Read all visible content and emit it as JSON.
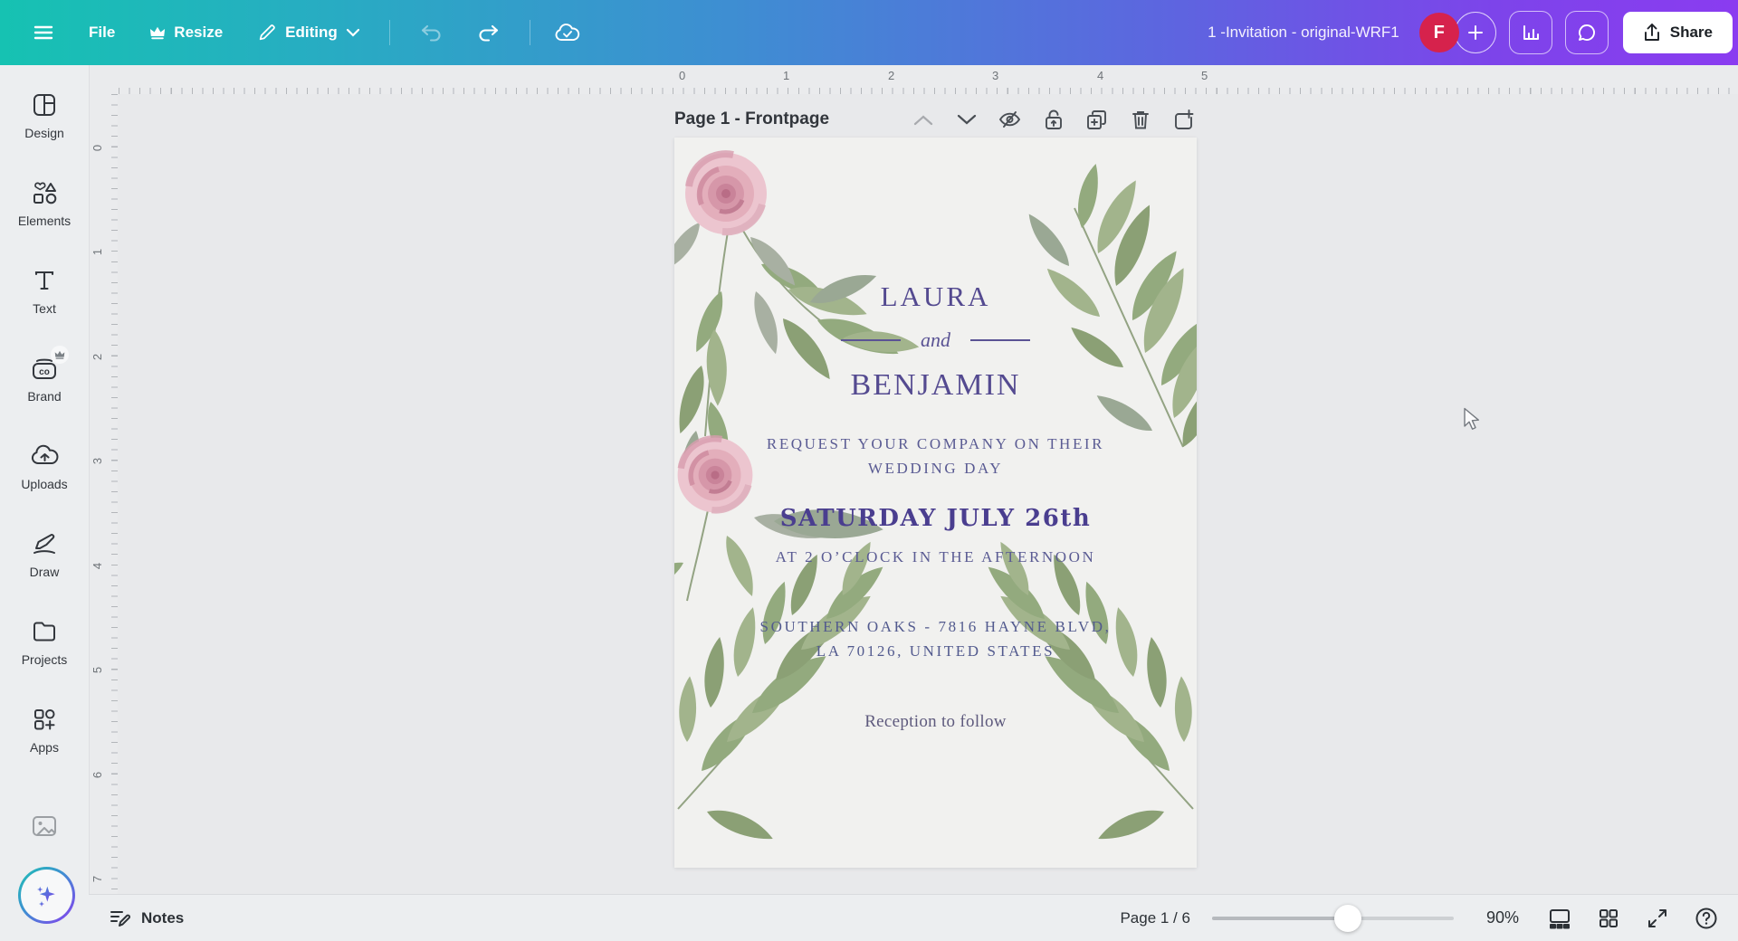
{
  "topbar": {
    "file_label": "File",
    "resize_label": "Resize",
    "editing_label": "Editing",
    "title": "1 -Invitation - original-WRF1",
    "avatar_letter": "F",
    "share_label": "Share"
  },
  "sidebar": {
    "items": [
      {
        "label": "Design"
      },
      {
        "label": "Elements"
      },
      {
        "label": "Text"
      },
      {
        "label": "Brand"
      },
      {
        "label": "Uploads"
      },
      {
        "label": "Draw"
      },
      {
        "label": "Projects"
      },
      {
        "label": "Apps"
      }
    ]
  },
  "rulers": {
    "horizontal": [
      "0",
      "1",
      "2",
      "3",
      "4",
      "5"
    ],
    "vertical": [
      "0",
      "1",
      "2",
      "3",
      "4",
      "5",
      "6",
      "7"
    ]
  },
  "page_header": {
    "label": "Page 1 - Frontpage"
  },
  "invitation": {
    "name1": "LAURA",
    "conjunction": "and",
    "name2": "BENJAMIN",
    "request_line1": "REQUEST YOUR COMPANY ON THEIR",
    "request_line2": "WEDDING DAY",
    "date": "SATURDAY JULY 26th",
    "time": "AT 2 O’CLOCK IN THE AFTERNOON",
    "venue_line1": "SOUTHERN OAKS - 7816 HAYNE BLVD,",
    "venue_line2": "LA 70126, UNITED STATES",
    "footer": "Reception to follow"
  },
  "bottombar": {
    "notes_label": "Notes",
    "page_indicator": "Page 1 / 6",
    "zoom_level": "90%"
  },
  "colors": {
    "gradient_start": "#16c2b2",
    "gradient_end": "#8a3cf0",
    "avatar": "#d6224c",
    "invitation_text": "#544a90",
    "card_background": "#f1f1ef"
  }
}
